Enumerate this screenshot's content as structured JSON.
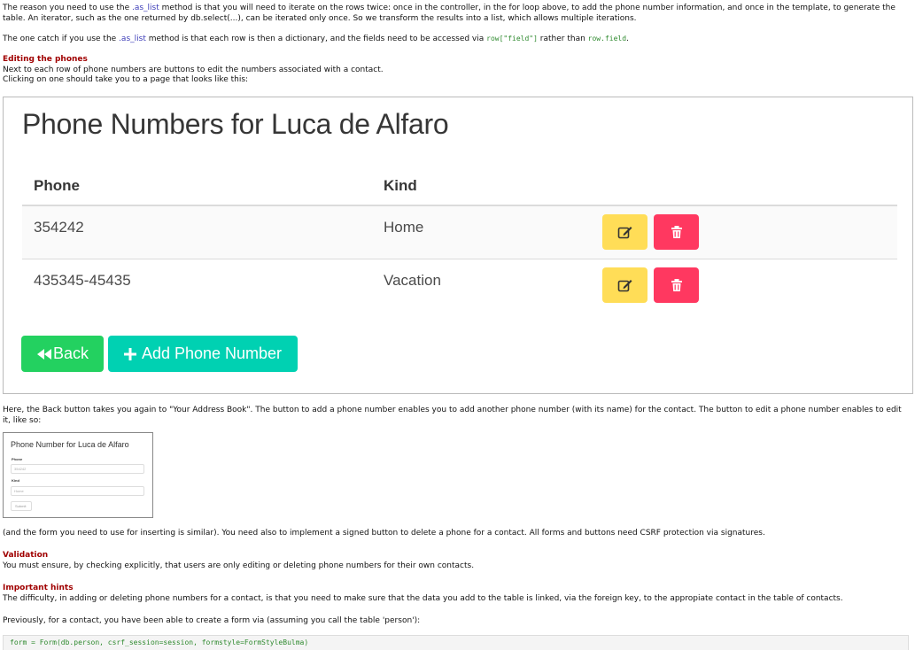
{
  "intro": {
    "p1a": "The reason you need to use the ",
    "as_list_1": ".as_list",
    "p1b": " method is that you will need to iterate on the rows twice: once in the controller, in the for loop above, to add the phone number information, and once in the template, to generate the table.  An iterator, such as the one returned by db.select(...), can be iterated only once.  So we transform the results into a list, which allows multiple iterations.",
    "p2a": "The one catch if you use the ",
    "as_list_2": ".as_list",
    "p2b": " method is that each row is then a dictionary, and the fields need to be accessed via ",
    "code_row": "row[\"field\"]",
    "p2c": " rather than ",
    "code_rowfield": "row.field",
    "p2d": "."
  },
  "editing": {
    "heading": "Editing the phones",
    "line1": "Next to each row of phone numbers are buttons to edit the numbers associated with a contact.",
    "line2": "Clicking on one should take you to a page that looks like this:"
  },
  "big_shot": {
    "title": "Phone Numbers for Luca de Alfaro",
    "col_phone": "Phone",
    "col_kind": "Kind",
    "rows": [
      {
        "phone": "354242",
        "kind": "Home"
      },
      {
        "phone": "435345-45435",
        "kind": "Vacation"
      }
    ],
    "back_label": "Back",
    "add_label": "Add Phone Number",
    "colors": {
      "edit": "#ffdd57",
      "delete": "#ff3860",
      "back": "#23d160",
      "add": "#00d1b2"
    }
  },
  "after_big": "Here, the Back button takes you again to \"Your Address Book\".  The button to add a phone number enables you to add another phone number (with its name) for the contact. The button to edit a phone number enables to edit it, like so:",
  "small_shot": {
    "title": "Phone Number for Luca de Alfaro",
    "label_phone": "Phone",
    "value_phone": "354242",
    "label_kind": "Kind",
    "value_kind": "Home",
    "submit": "Submit"
  },
  "after_small": "(and the form you need to use for inserting is similar).  You need also to implement a signed button to delete a phone for a contact.  All forms and buttons need CSRF protection via signatures.",
  "validation": {
    "heading": "Validation",
    "text": "You must ensure, by checking explicitly, that users are only editing or deleting phone numbers for their own contacts."
  },
  "hints": {
    "heading": "Important hints",
    "text": "The difficulty, in adding or deleting phone numbers for a contact, is that you need to make sure that the data you add to the table is linked, via the foreign key, to the appropiate contact in the table of contacts.",
    "previously": "Previously, for a contact, you have been able to create a form via (assuming you call the table 'person'):",
    "code": "form = Form(db.person, csrf_session=session, formstyle=FormStyleBulma)"
  }
}
